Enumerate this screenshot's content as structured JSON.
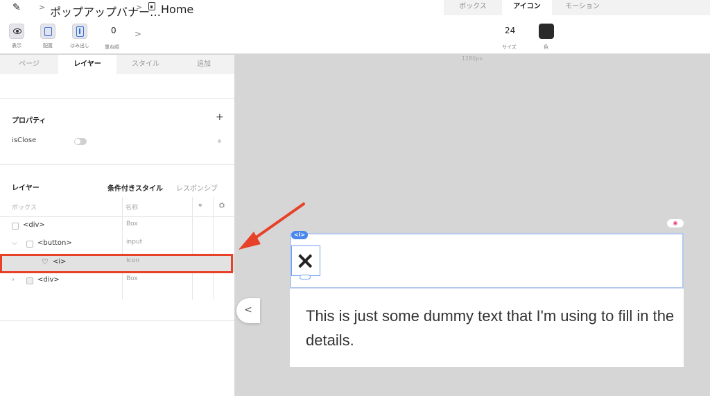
{
  "breadcrumb": {
    "project": "ポップアップバナー…",
    "page": "Home",
    "separator": ">"
  },
  "mode_tabs": [
    "ボックス",
    "アイコン",
    "モーション"
  ],
  "active_mode_tab": "アイコン",
  "toolbar": {
    "view_label": "表示",
    "layout_label": "配置",
    "overflow_label": "はみ出し",
    "stack_order_label": "重ね順",
    "stack_order_value": "0",
    "size_label": "サイズ",
    "size_value": "24",
    "color_label": "色",
    "color_value": "#2a2a2a"
  },
  "panel_tabs": [
    "ページ",
    "レイヤー",
    "スタイル",
    "追加"
  ],
  "active_panel_tab": "レイヤー",
  "properties": {
    "title": "プロパティ",
    "add": "+",
    "items": [
      {
        "label": "isClose",
        "enabled": false
      }
    ]
  },
  "layers": {
    "title": "レイヤー",
    "conditional_style": "条件付きスタイル",
    "responsive": "レスポンシブ",
    "col_box": "ボックス",
    "col_name": "名称",
    "rows": [
      {
        "name": "<div>",
        "type": "Box"
      },
      {
        "name": "<button>",
        "type": "input"
      },
      {
        "name": "<i>",
        "type": "Icon",
        "selected": true
      },
      {
        "name": "<div>",
        "type": "Box"
      }
    ]
  },
  "canvas": {
    "width_label": "1280px",
    "element_badge": "<i>",
    "close_icon": "×",
    "body_text": "This is just some dummy text that I'm using to fill in the details.",
    "collapse_icon": "<"
  },
  "accent_colors": {
    "selection_blue": "#4a86ee",
    "highlight_red": "#e8412a"
  }
}
